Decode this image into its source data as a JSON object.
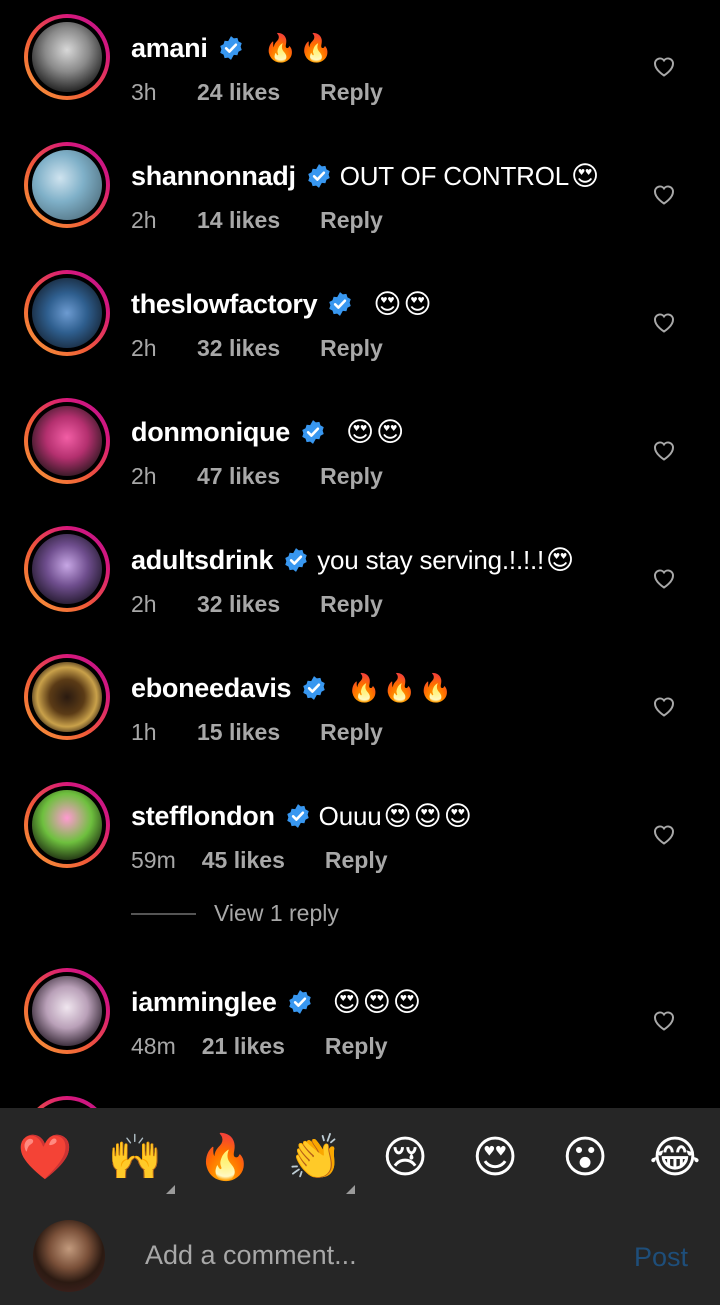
{
  "comments": [
    {
      "username": "amani",
      "text": "",
      "emoji": "🔥🔥",
      "time": "3h",
      "likes": "24 likes",
      "reply": "Reply"
    },
    {
      "username": "shannonnadj",
      "text": "OUT OF CONTROL",
      "emoji": "😍",
      "time": "2h",
      "likes": "14 likes",
      "reply": "Reply"
    },
    {
      "username": "theslowfactory",
      "text": "",
      "emoji": "😍😍",
      "time": "2h",
      "likes": "32 likes",
      "reply": "Reply"
    },
    {
      "username": "donmonique",
      "text": "",
      "emoji": "😍😍",
      "time": "2h",
      "likes": "47 likes",
      "reply": "Reply"
    },
    {
      "username": "adultsdrink",
      "text": "you stay serving.!.!.!",
      "emoji": "😍",
      "time": "2h",
      "likes": "32 likes",
      "reply": "Reply"
    },
    {
      "username": "eboneedavis",
      "text": "",
      "emoji": "🔥🔥🔥",
      "time": "1h",
      "likes": "15 likes",
      "reply": "Reply"
    },
    {
      "username": "stefflondon",
      "text": "Ouuu",
      "emoji": "😍😍😍",
      "time": "59m",
      "likes": "45 likes",
      "reply": "Reply"
    },
    {
      "username": "iamminglee",
      "text": "",
      "emoji": "😍😍😍",
      "time": "48m",
      "likes": "21 likes",
      "reply": "Reply"
    }
  ],
  "view_replies": "View 1 reply",
  "reactions": [
    "❤️",
    "🙌",
    "🔥",
    "👏",
    "😢",
    "😍",
    "😮",
    "😂"
  ],
  "composer": {
    "placeholder": "Add a comment...",
    "post_label": "Post"
  },
  "colors": {
    "verified": "#3897f0",
    "background": "#000000",
    "bar": "#262626",
    "post_disabled": "#1e4e7a"
  }
}
